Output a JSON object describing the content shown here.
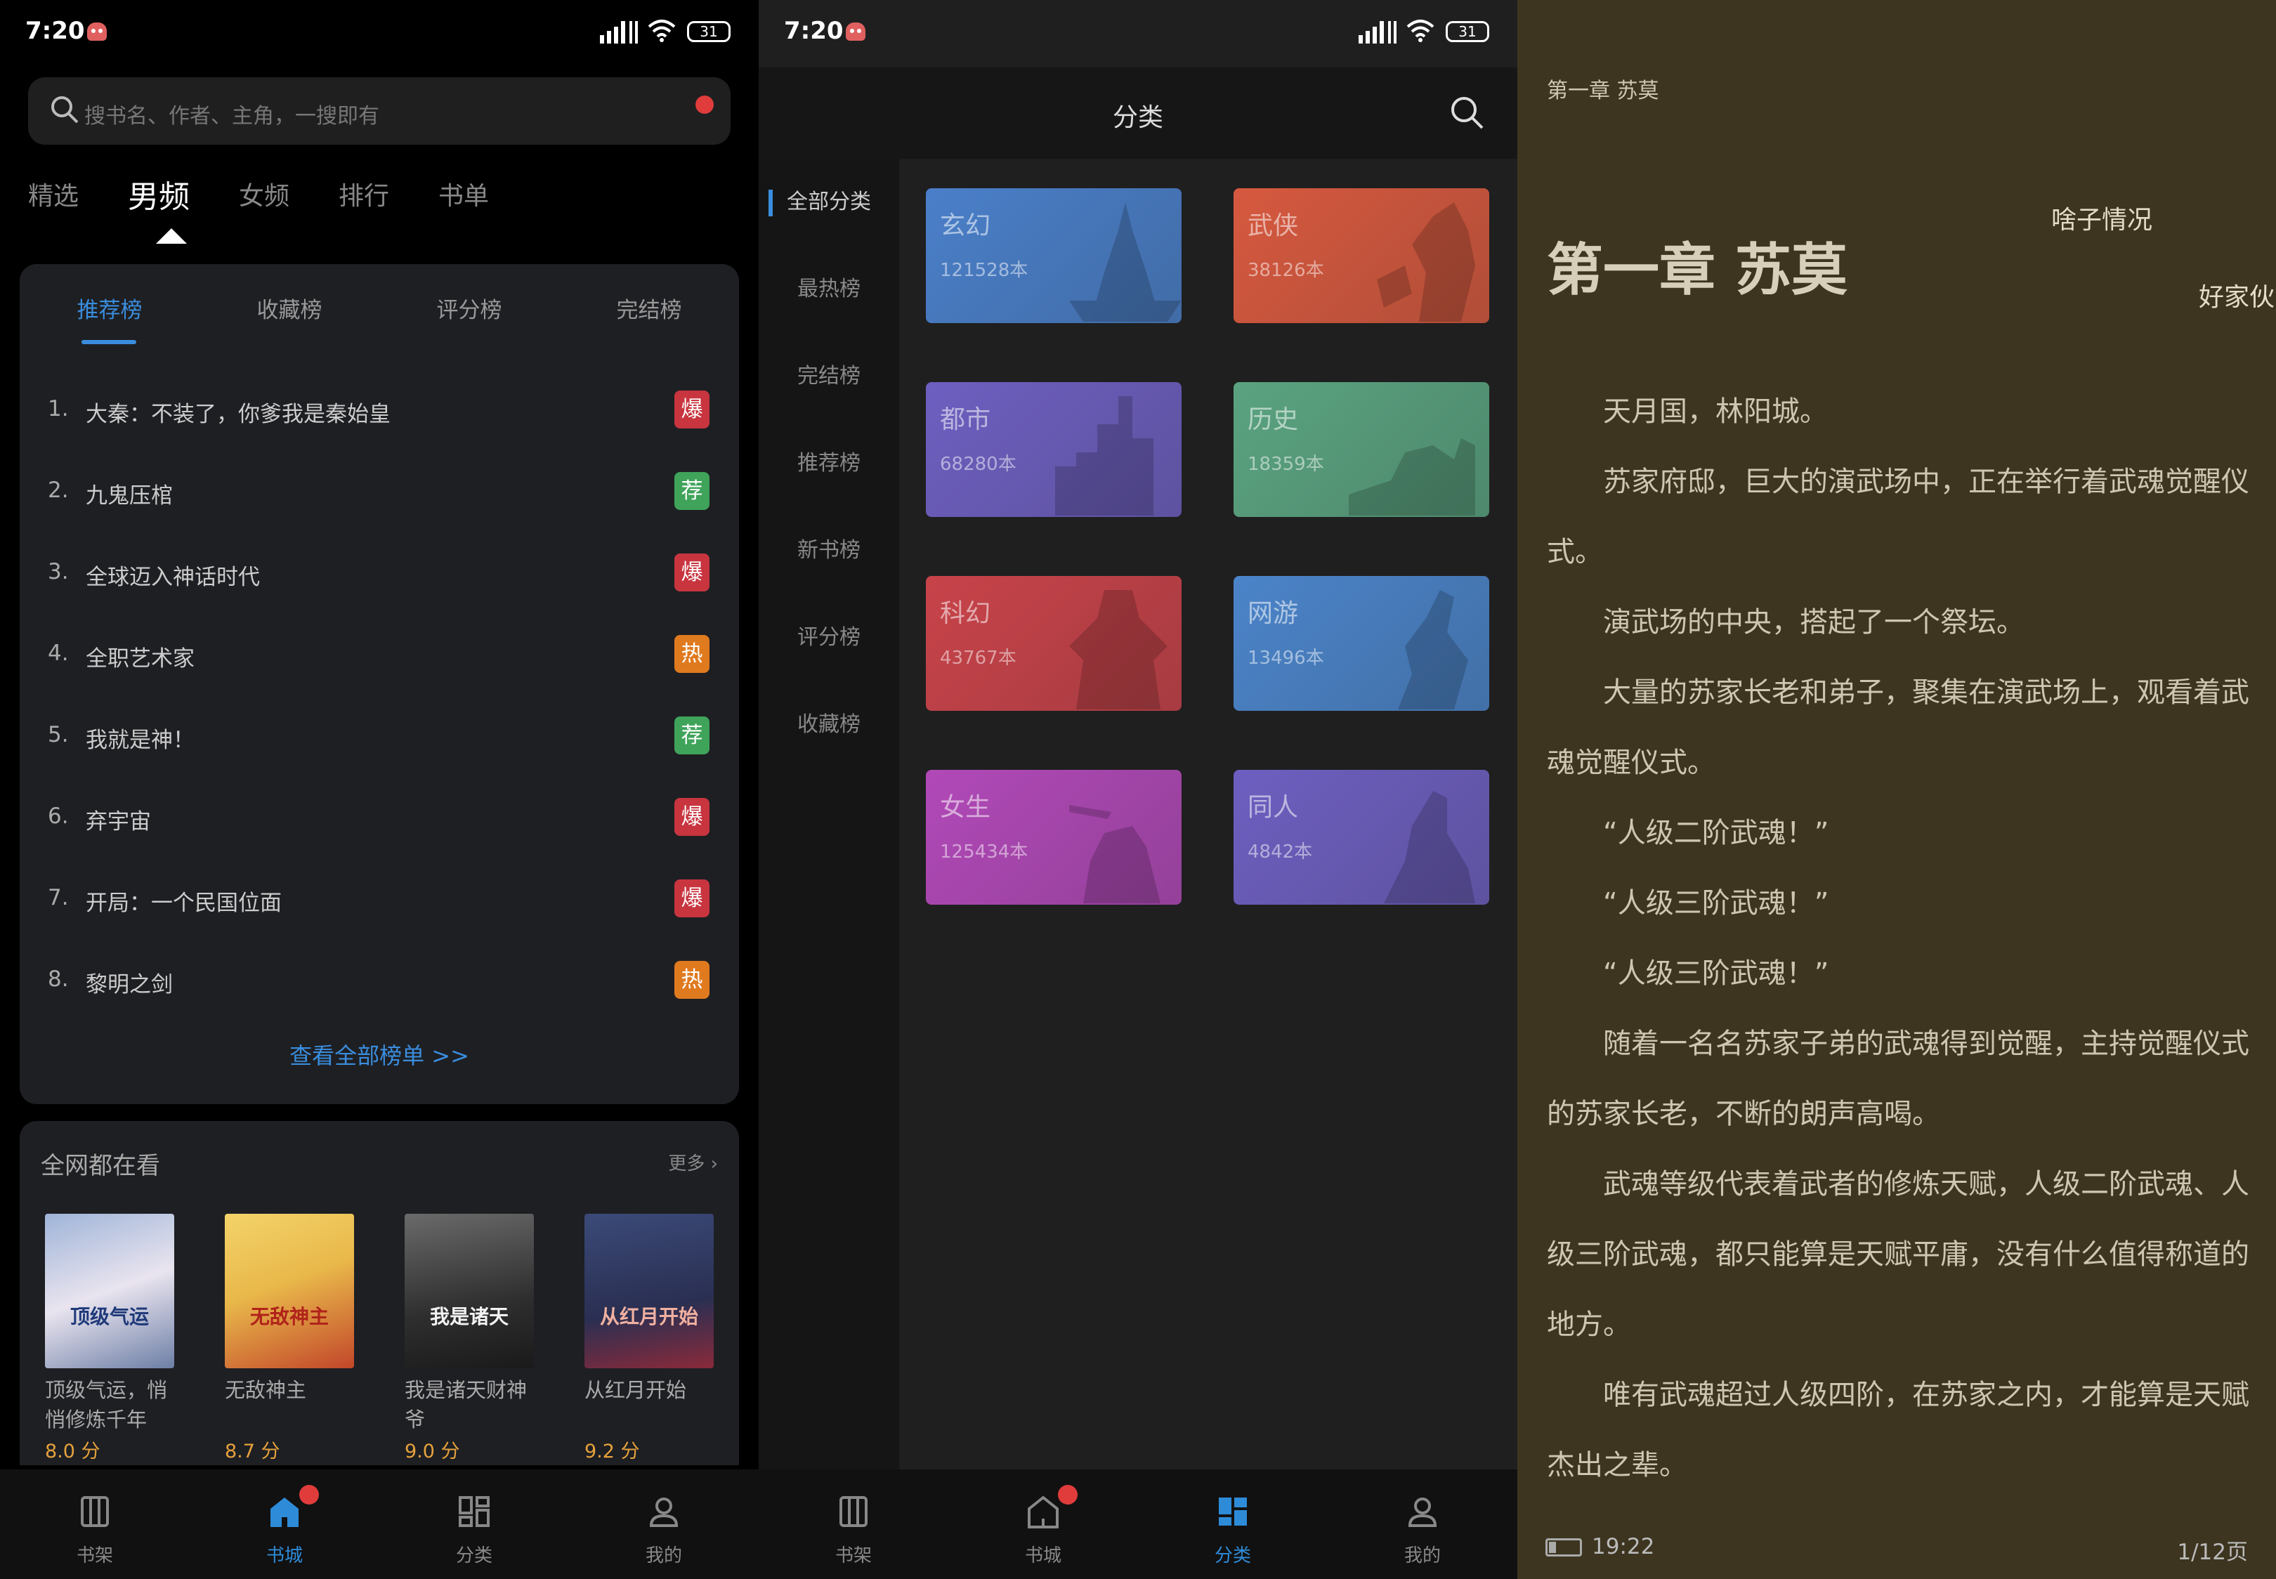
{
  "status_bar": {
    "time": "7:20",
    "battery": "31"
  },
  "bookstore": {
    "search_placeholder": "搜书名、作者、主角，一搜即有",
    "top_tabs": [
      "精选",
      "男频",
      "女频",
      "排行",
      "书单"
    ],
    "rank_tabs": [
      "推荐榜",
      "收藏榜",
      "评分榜",
      "完结榜"
    ],
    "rank_items": [
      {
        "num": "1.",
        "title": "大秦：不装了，你爹我是秦始皇",
        "badge": "爆",
        "badge_color": "#c8353f"
      },
      {
        "num": "2.",
        "title": "九鬼压棺",
        "badge": "荐",
        "badge_color": "#3fa35a"
      },
      {
        "num": "3.",
        "title": "全球迈入神话时代",
        "badge": "爆",
        "badge_color": "#c8353f"
      },
      {
        "num": "4.",
        "title": "全职艺术家",
        "badge": "热",
        "badge_color": "#e07a1f"
      },
      {
        "num": "5.",
        "title": "我就是神！",
        "badge": "荐",
        "badge_color": "#3fa35a"
      },
      {
        "num": "6.",
        "title": "弃宇宙",
        "badge": "爆",
        "badge_color": "#c8353f"
      },
      {
        "num": "7.",
        "title": "开局：一个民国位面",
        "badge": "爆",
        "badge_color": "#c8353f"
      },
      {
        "num": "8.",
        "title": "黎明之剑",
        "badge": "热",
        "badge_color": "#e07a1f"
      }
    ],
    "view_all": "查看全部榜单 >>",
    "hot_title": "全网都在看",
    "hot_more": "更多",
    "books": [
      {
        "title": "顶级气运，悄悄修炼千年",
        "score": "8.0 分",
        "cover_text": "顶级气运"
      },
      {
        "title": "无敌神主",
        "score": "8.7 分",
        "cover_text": "无敌神主"
      },
      {
        "title": "我是诸天财神爷",
        "score": "9.0 分",
        "cover_text": "我是诸天"
      },
      {
        "title": "从红月开始",
        "score": "9.2 分",
        "cover_text": "从红月开始"
      }
    ]
  },
  "bottom_nav": [
    "书架",
    "书城",
    "分类",
    "我的"
  ],
  "category": {
    "title": "分类",
    "side_items": [
      "全部分类",
      "最热榜",
      "完结榜",
      "推荐榜",
      "新书榜",
      "评分榜",
      "收藏榜"
    ],
    "cards": [
      {
        "name": "玄幻",
        "count": "121528本",
        "color": "#4a7fc9"
      },
      {
        "name": "武侠",
        "count": "38126本",
        "color": "#d6593f"
      },
      {
        "name": "都市",
        "count": "68280本",
        "color": "#6d5fc0"
      },
      {
        "name": "历史",
        "count": "18359本",
        "color": "#5aa380"
      },
      {
        "name": "科幻",
        "count": "43767本",
        "color": "#c8434a"
      },
      {
        "name": "网游",
        "count": "13496本",
        "color": "#4b84c9"
      },
      {
        "name": "女生",
        "count": "125434本",
        "color": "#b149b8"
      },
      {
        "name": "同人",
        "count": "4842本",
        "color": "#6d5fc0"
      }
    ]
  },
  "reader": {
    "chapter_small": "第一章 苏莫",
    "chapter_title": "第一章 苏莫",
    "danmu": [
      "啥子情况",
      "好家伙"
    ],
    "paragraphs": [
      "天月国，林阳城。",
      "苏家府邸，巨大的演武场中，正在举行着武魂觉醒仪式。",
      "演武场的中央，搭起了一个祭坛。",
      "大量的苏家长老和弟子，聚集在演武场上，观看着武魂觉醒仪式。",
      "“人级二阶武魂！”",
      "“人级三阶武魂！”",
      "“人级三阶武魂！”",
      "随着一名名苏家子弟的武魂得到觉醒，主持觉醒仪式的苏家长老，不断的朗声高喝。",
      "武魂等级代表着武者的修炼天赋，人级二阶武魂、人级三阶武魂，都只能算是天赋平庸，没有什么值得称道的地方。",
      "唯有武魂超过人级四阶，在苏家之内，才能算是天赋杰出之辈。"
    ],
    "time": "19:22",
    "page": "1/12页"
  }
}
